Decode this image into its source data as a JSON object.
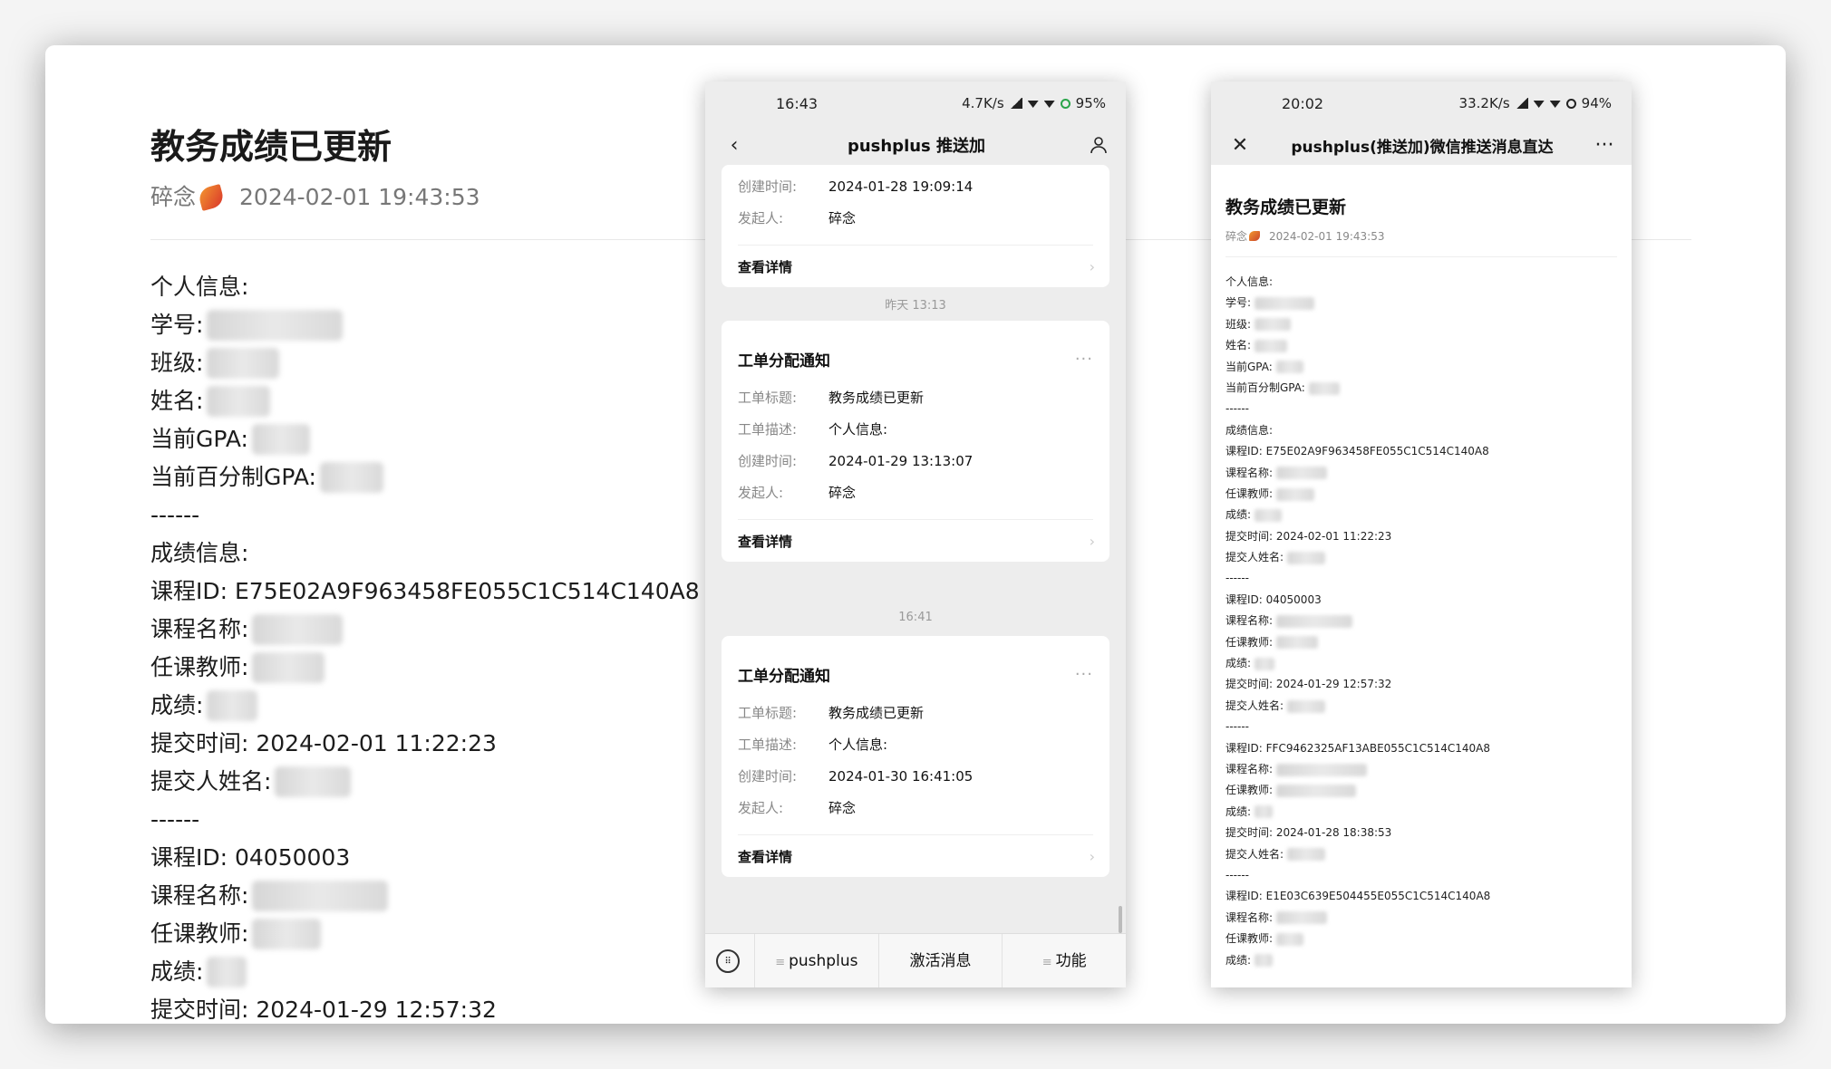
{
  "left_doc": {
    "title": "教务成绩已更新",
    "author": "碎念",
    "timestamp": "2024-02-01 19:43:53",
    "lines": [
      {
        "label": "个人信息:",
        "blur": 0
      },
      {
        "label": "学号:",
        "blur": 150
      },
      {
        "label": "班级:",
        "blur": 80
      },
      {
        "label": "姓名:",
        "blur": 70
      },
      {
        "label": "当前GPA:",
        "blur": 64
      },
      {
        "label": "当前百分制GPA:",
        "blur": 70
      },
      {
        "label": "------",
        "blur": 0
      },
      {
        "label": "成绩信息:",
        "blur": 0
      },
      {
        "label": "课程ID: E75E02A9F963458FE055C1C514C140A8",
        "blur": 0
      },
      {
        "label": "课程名称:",
        "blur": 100
      },
      {
        "label": "任课教师:",
        "blur": 80
      },
      {
        "label": "成绩:",
        "blur": 56
      },
      {
        "label": "提交时间: 2024-02-01 11:22:23",
        "blur": 0
      },
      {
        "label": "提交人姓名:",
        "blur": 84
      },
      {
        "label": "------",
        "blur": 0
      },
      {
        "label": "课程ID: 04050003",
        "blur": 0
      },
      {
        "label": "课程名称:",
        "blur": 150
      },
      {
        "label": "任课教师:",
        "blur": 76
      },
      {
        "label": "成绩:",
        "blur": 44
      },
      {
        "label": "提交时间: 2024-01-29 12:57:32",
        "blur": 0
      }
    ]
  },
  "phone1": {
    "status": {
      "time": "16:43",
      "speed": "4.7K/s",
      "battery": "95%"
    },
    "nav_title": "pushplus 推送加",
    "card0": {
      "rows": [
        {
          "k": "创建时间:",
          "v": "2024-01-28 19:09:14"
        },
        {
          "k": "发起人:",
          "v": "碎念"
        }
      ],
      "detail": "查看详情"
    },
    "sep1": "昨天 13:13",
    "card1": {
      "title": "工单分配通知",
      "rows": [
        {
          "k": "工单标题:",
          "v": "教务成绩已更新"
        },
        {
          "k": "工单描述:",
          "v": "个人信息:"
        },
        {
          "k": "创建时间:",
          "v": "2024-01-29 13:13:07"
        },
        {
          "k": "发起人:",
          "v": "碎念"
        }
      ],
      "detail": "查看详情"
    },
    "sep2": "16:41",
    "card2": {
      "title": "工单分配通知",
      "rows": [
        {
          "k": "工单标题:",
          "v": "教务成绩已更新"
        },
        {
          "k": "工单描述:",
          "v": "个人信息:"
        },
        {
          "k": "创建时间:",
          "v": "2024-01-30 16:41:05"
        },
        {
          "k": "发起人:",
          "v": "碎念"
        }
      ],
      "detail": "查看详情"
    },
    "menu": [
      "pushplus",
      "激活消息",
      "功能"
    ]
  },
  "phone2": {
    "status": {
      "time": "20:02",
      "speed": "33.2K/s",
      "battery": "94%"
    },
    "nav_title": "pushplus(推送加)微信推送消息直达",
    "article": {
      "title": "教务成绩已更新",
      "author": "碎念",
      "timestamp": "2024-02-01 19:43:53",
      "lines": [
        {
          "label": "个人信息:",
          "blur": 0
        },
        {
          "label": "学号:",
          "blur": 66
        },
        {
          "label": "班级:",
          "blur": 40
        },
        {
          "label": "姓名:",
          "blur": 36
        },
        {
          "label": "当前GPA:",
          "blur": 30
        },
        {
          "label": "当前百分制GPA:",
          "blur": 34
        },
        {
          "label": "------",
          "blur": 0
        },
        {
          "label": "成绩信息:",
          "blur": 0
        },
        {
          "label": "课程ID: E75E02A9F963458FE055C1C514C140A8",
          "blur": 0
        },
        {
          "label": "课程名称:",
          "blur": 56
        },
        {
          "label": "任课教师:",
          "blur": 42
        },
        {
          "label": "成绩:",
          "blur": 30
        },
        {
          "label": "提交时间: 2024-02-01 11:22:23",
          "blur": 0
        },
        {
          "label": "提交人姓名:",
          "blur": 42
        },
        {
          "label": "------",
          "blur": 0
        },
        {
          "label": "课程ID: 04050003",
          "blur": 0
        },
        {
          "label": "课程名称:",
          "blur": 84
        },
        {
          "label": "任课教师:",
          "blur": 46
        },
        {
          "label": "成绩:",
          "blur": 22
        },
        {
          "label": "提交时间: 2024-01-29 12:57:32",
          "blur": 0
        },
        {
          "label": "提交人姓名:",
          "blur": 42
        },
        {
          "label": "------",
          "blur": 0
        },
        {
          "label": "课程ID: FFC9462325AF13ABE055C1C514C140A8",
          "blur": 0
        },
        {
          "label": "课程名称:",
          "blur": 100
        },
        {
          "label": "任课教师:",
          "blur": 88
        },
        {
          "label": "成绩:",
          "blur": 20
        },
        {
          "label": "提交时间: 2024-01-28 18:38:53",
          "blur": 0
        },
        {
          "label": "提交人姓名:",
          "blur": 42
        },
        {
          "label": "------",
          "blur": 0
        },
        {
          "label": "课程ID: E1E03C639E504455E055C1C514C140A8",
          "blur": 0
        },
        {
          "label": "课程名称:",
          "blur": 56
        },
        {
          "label": "任课教师:",
          "blur": 30
        },
        {
          "label": "成绩:",
          "blur": 20
        }
      ]
    }
  }
}
